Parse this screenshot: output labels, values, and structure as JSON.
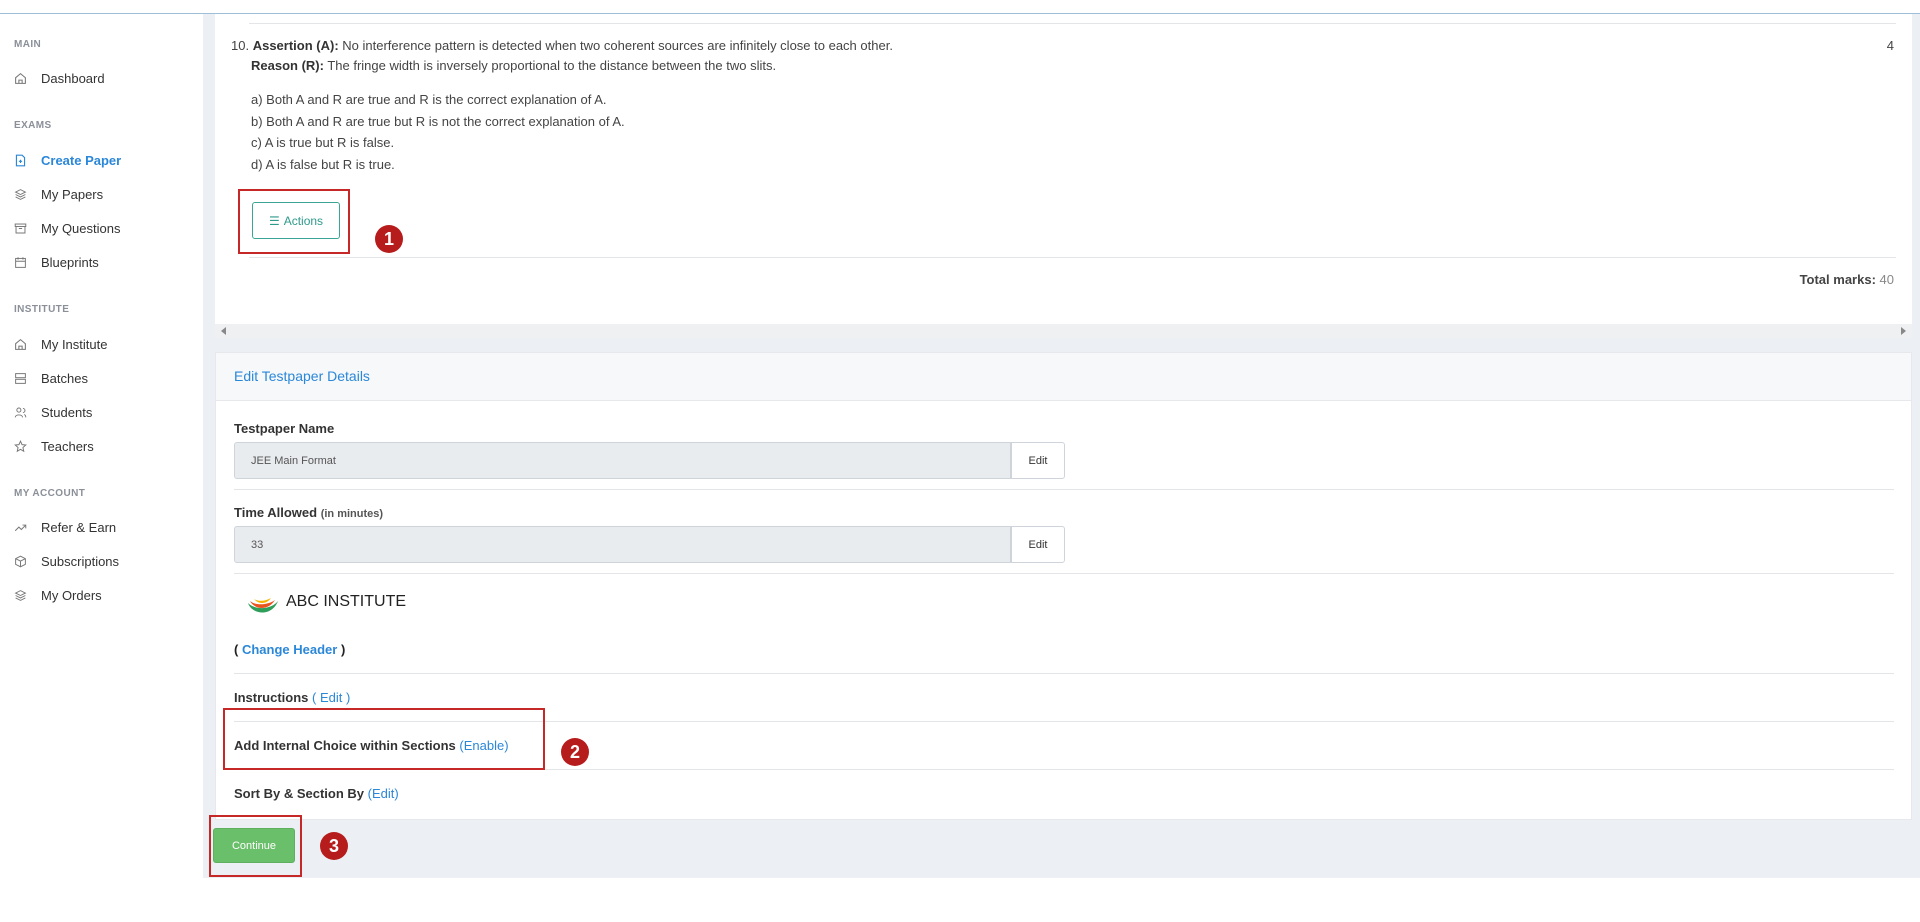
{
  "sidebar": {
    "sections": [
      {
        "heading": "MAIN",
        "items": [
          {
            "label": "Dashboard",
            "icon": "home-icon"
          }
        ]
      },
      {
        "heading": "EXAMS",
        "items": [
          {
            "label": "Create Paper",
            "icon": "document-icon",
            "active": true
          },
          {
            "label": "My Papers",
            "icon": "layers-icon"
          },
          {
            "label": "My Questions",
            "icon": "archive-icon"
          },
          {
            "label": "Blueprints",
            "icon": "calendar-icon"
          }
        ]
      },
      {
        "heading": "INSTITUTE",
        "items": [
          {
            "label": "My Institute",
            "icon": "home-icon"
          },
          {
            "label": "Batches",
            "icon": "server-icon"
          },
          {
            "label": "Students",
            "icon": "users-icon"
          },
          {
            "label": "Teachers",
            "icon": "star-icon"
          }
        ]
      },
      {
        "heading": "MY ACCOUNT",
        "items": [
          {
            "label": "Refer & Earn",
            "icon": "trending-up-icon"
          },
          {
            "label": "Subscriptions",
            "icon": "box-icon"
          },
          {
            "label": "My Orders",
            "icon": "layers-icon"
          }
        ]
      }
    ],
    "active_color": "#2b87d8"
  },
  "question": {
    "number": "10.",
    "assertion_label": "Assertion (A):",
    "assertion_text": "No interference pattern is detected when two coherent sources are infinitely close to each other.",
    "reason_label": "Reason (R):",
    "reason_text": "The fringe width is inversely proportional to the distance between the two slits.",
    "options": [
      "a) Both A and R are true and R is the correct explanation of A.",
      "b) Both A and R are true but R is not the correct explanation of A.",
      "c) A is true but R is false.",
      "d) A is false but R is true."
    ],
    "marks": "4",
    "actions_label": "Actions",
    "total_marks_label": "Total marks:",
    "total_marks_value": "40"
  },
  "edit": {
    "title": "Edit Testpaper Details",
    "name_label": "Testpaper Name",
    "name_value": "JEE Main Format",
    "time_label": "Time Allowed",
    "time_unit": "(in minutes)",
    "time_value": "33",
    "edit_label": "Edit",
    "institute_name": "ABC INSTITUTE",
    "change_header_open": "(",
    "change_header_link": "Change Header",
    "change_header_close": ")",
    "instructions_label": "Instructions",
    "instructions_link": "Edit",
    "internal_choice_label": "Add Internal Choice within Sections",
    "internal_choice_link": "Enable",
    "sort_label": "Sort By & Section By",
    "sort_link": "Edit",
    "continue_label": "Continue"
  },
  "annotations": {
    "badge_1": "1",
    "badge_2": "2",
    "badge_3": "3",
    "color": "#c62828"
  },
  "colors": {
    "accent_blue": "#2b87d8",
    "actions_teal": "#2f9a8c",
    "continue_green": "#6abf6a"
  }
}
